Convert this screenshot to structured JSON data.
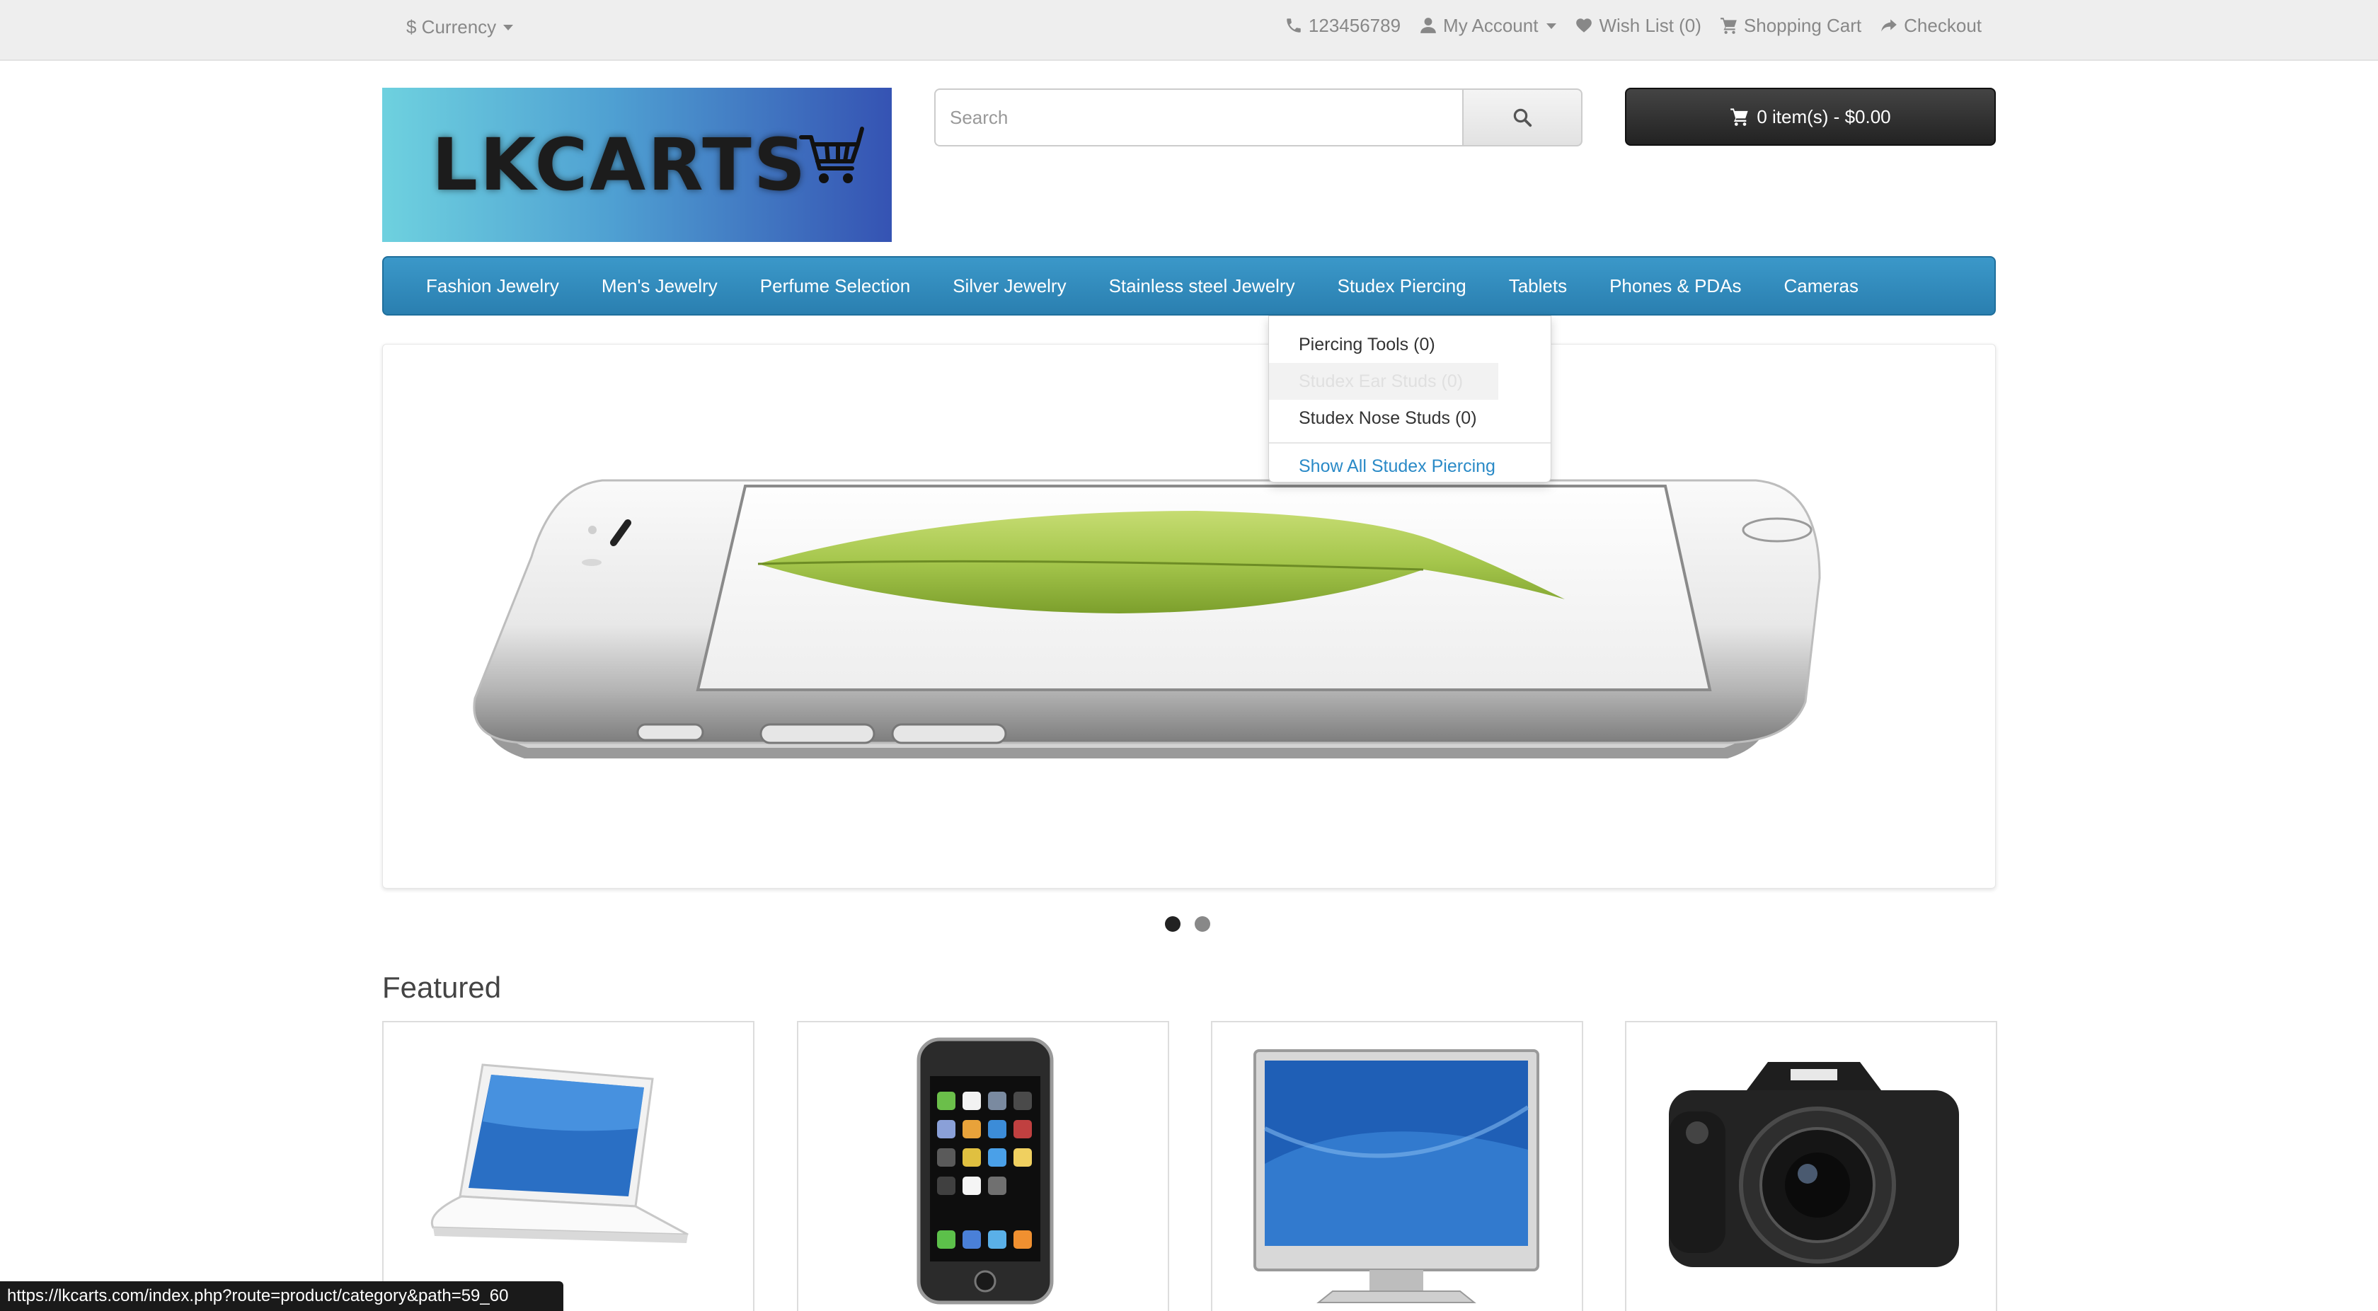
{
  "topbar": {
    "currency_label": "$ Currency",
    "phone": "123456789",
    "my_account": "My Account",
    "wish_list": "Wish List (0)",
    "shopping_cart": "Shopping Cart",
    "checkout": "Checkout"
  },
  "header": {
    "logo_text": "LKCARTS",
    "search_placeholder": "Search",
    "cart_button": "0 item(s) - $0.00"
  },
  "nav": {
    "items": [
      "Fashion Jewelry",
      "Men's Jewelry",
      "Perfume Selection",
      "Silver Jewelry",
      "Stainless steel Jewelry",
      "Studex Piercing",
      "Tablets",
      "Phones & PDAs",
      "Cameras"
    ]
  },
  "dropdown": {
    "items": [
      "Piercing Tools (0)",
      "Studex Ear Studs (0)",
      "Studex Nose Studs (0)"
    ],
    "show_all": "Show All Studex Piercing"
  },
  "slideshow": {
    "active_slide": 1,
    "slide_count": 2
  },
  "featured": {
    "title": "Featured",
    "products": [
      {
        "icon": "laptop-icon"
      },
      {
        "icon": "phone-icon"
      },
      {
        "icon": "monitor-icon"
      },
      {
        "icon": "camera-icon"
      }
    ]
  },
  "statusbar": {
    "url": "https://lkcarts.com/index.php?route=product/category&path=59_60"
  },
  "colors": {
    "nav_blue": "#2a7fb0",
    "link_blue": "#2a8ac7",
    "cart_dark": "#222222"
  }
}
